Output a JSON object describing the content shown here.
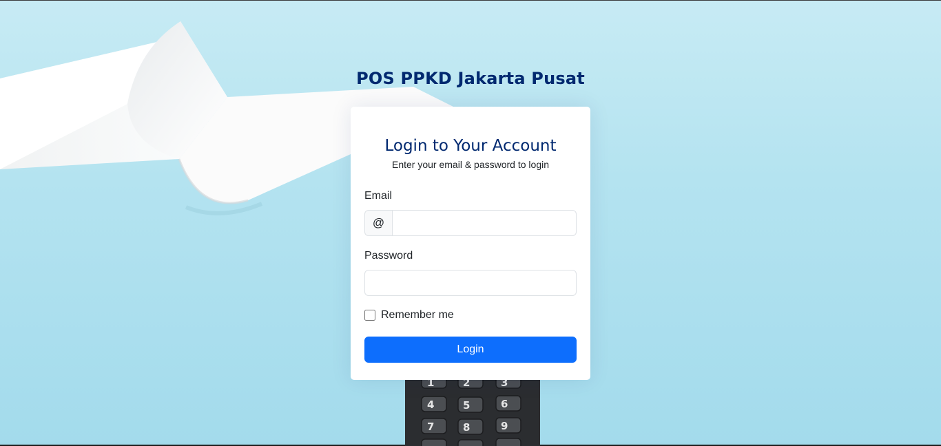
{
  "site": {
    "title": "POS PPKD Jakarta Pusat"
  },
  "login_card": {
    "title": "Login to Your Account",
    "subtitle": "Enter your email & password to login",
    "email": {
      "label": "Email",
      "prefix": "@",
      "value": ""
    },
    "password": {
      "label": "Password",
      "value": ""
    },
    "remember": {
      "label": "Remember me",
      "checked": false
    },
    "submit_label": "Login"
  },
  "colors": {
    "title": "#012970",
    "primary_button": "#0d6efd",
    "background": "#b4e3f0"
  },
  "icons": {
    "background_art": "receipt-paper-and-card-terminal"
  }
}
